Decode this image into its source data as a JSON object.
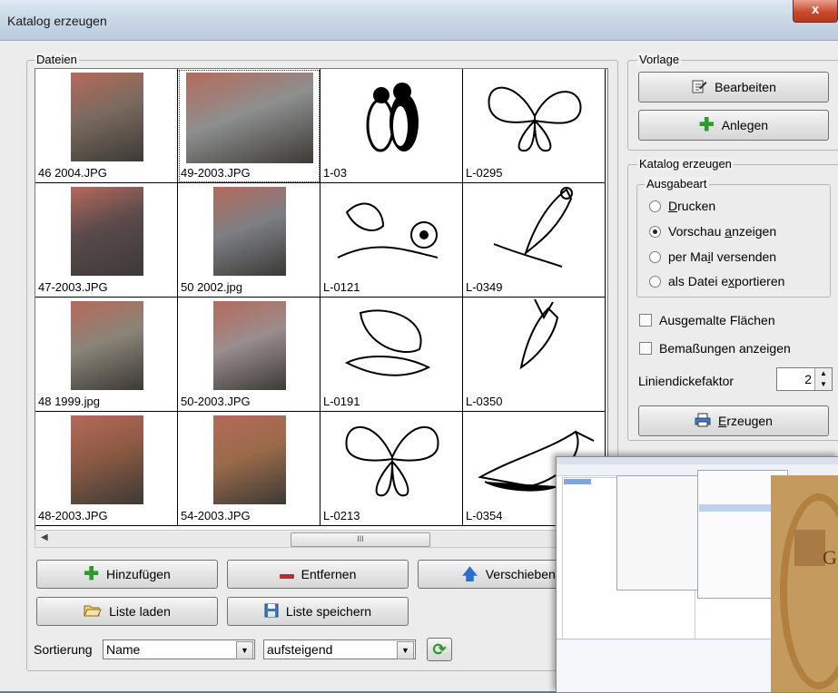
{
  "window": {
    "title": "Katalog erzeugen",
    "close_label": "x"
  },
  "files": {
    "group_label": "Dateien",
    "items": [
      {
        "label": "46 2004.JPG",
        "kind": "photo",
        "color": "#7a6a5f"
      },
      {
        "label": "49-2003.JPG",
        "kind": "photo",
        "color": "#8d8f8f"
      },
      {
        "label": "1-03",
        "kind": "clipart-penguins"
      },
      {
        "label": "L-0295",
        "kind": "clipart-butterfly"
      },
      {
        "label": "47-2003.JPG",
        "kind": "photo",
        "color": "#5a4a4c"
      },
      {
        "label": "50 2002.jpg",
        "kind": "photo",
        "color": "#7d7f84"
      },
      {
        "label": "L-0121",
        "kind": "clipart-bird-flower"
      },
      {
        "label": "L-0349",
        "kind": "clipart-bird-branch"
      },
      {
        "label": "48 1999.jpg",
        "kind": "photo",
        "color": "#8a8478"
      },
      {
        "label": "50-2003.JPG",
        "kind": "photo",
        "color": "#9a8d8e"
      },
      {
        "label": "L-0191",
        "kind": "clipart-dove"
      },
      {
        "label": "L-0350",
        "kind": "clipart-bird-small"
      },
      {
        "label": "48-2003.JPG",
        "kind": "photo",
        "color": "#8c5a44"
      },
      {
        "label": "54-2003.JPG",
        "kind": "photo",
        "color": "#9a6a4a"
      },
      {
        "label": "L-0213",
        "kind": "clipart-butterfly-outline"
      },
      {
        "label": "L-0354",
        "kind": "clipart-pigeon"
      }
    ],
    "scrollbar_thumb": "III"
  },
  "buttons": {
    "add": "Hinzufügen",
    "remove": "Entfernen",
    "move": "Verschieben",
    "load_list": "Liste laden",
    "save_list": "Liste speichern"
  },
  "sort": {
    "label": "Sortierung",
    "field_value": "Name",
    "order_value": "aufsteigend"
  },
  "template": {
    "group_label": "Vorlage",
    "edit": "Bearbeiten",
    "create": "Anlegen"
  },
  "catalog": {
    "group_label": "Katalog erzeugen",
    "output_group_label": "Ausgabeart",
    "options": [
      {
        "pre": "",
        "acc": "D",
        "post": "rucken",
        "selected": false
      },
      {
        "pre": "Vorschau ",
        "acc": "a",
        "post": "nzeigen",
        "selected": true
      },
      {
        "pre": "per Ma",
        "acc": "i",
        "post": "l versenden",
        "selected": false
      },
      {
        "pre": "als Datei e",
        "acc": "x",
        "post": "portieren",
        "selected": false
      }
    ],
    "painted_surfaces": "Ausgemalte Flächen",
    "dimensions": "Bemaßungen anzeigen",
    "line_factor_label": "Liniendickefaktor",
    "line_factor_value": "2",
    "generate_acc": "E",
    "generate_rest": "rzeugen"
  },
  "colors": {
    "accent_green": "#2e9a2e",
    "accent_red": "#c0282a",
    "accent_blue": "#2a6fd0"
  }
}
